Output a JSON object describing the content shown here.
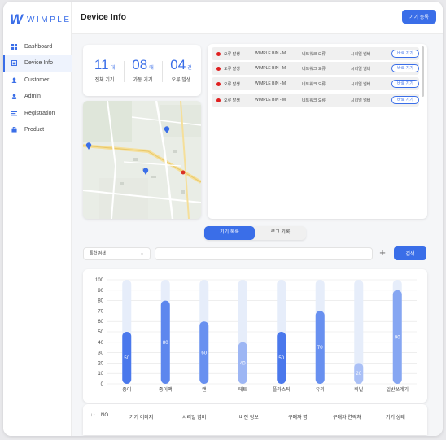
{
  "brand": {
    "mark": "W",
    "wordmark": "WIMPLE",
    "color": "#3a6ee8"
  },
  "sidebar": {
    "items": [
      {
        "label": "Dashboard",
        "icon": "dashboard-icon",
        "active": false
      },
      {
        "label": "Device Info",
        "icon": "device-icon",
        "active": true
      },
      {
        "label": "Customer",
        "icon": "customer-icon",
        "active": false
      },
      {
        "label": "Admin",
        "icon": "admin-icon",
        "active": false
      },
      {
        "label": "Registration",
        "icon": "registration-icon",
        "active": false
      },
      {
        "label": "Product",
        "icon": "product-icon",
        "active": false
      }
    ]
  },
  "header": {
    "title": "Device Info",
    "register_label": "기기 등록"
  },
  "stats": [
    {
      "value": "11",
      "unit": "대",
      "label": "전체 기기"
    },
    {
      "value": "08",
      "unit": "대",
      "label": "가동 기기"
    },
    {
      "value": "04",
      "unit": "건",
      "label": "오류 발생"
    }
  ],
  "alerts": [
    {
      "status": "오류 발생",
      "device": "WIMPLE BIN - M",
      "error": "네트워크 오류",
      "serial": "시리얼 넘버",
      "action": "바로 가기"
    },
    {
      "status": "오류 발생",
      "device": "WIMPLE BIN - M",
      "error": "네트워크 오류",
      "serial": "시리얼 넘버",
      "action": "바로 가기"
    },
    {
      "status": "오류 발생",
      "device": "WIMPLE BIN - M",
      "error": "네트워크 오류",
      "serial": "시리얼 넘버",
      "action": "바로 가기"
    },
    {
      "status": "오류 발생",
      "device": "WIMPLE BIN - M",
      "error": "네트워크 오류",
      "serial": "시리얼 넘버",
      "action": "바로 가기"
    }
  ],
  "tabs": [
    {
      "label": "기기 목록",
      "active": true
    },
    {
      "label": "로그 기록",
      "active": false
    }
  ],
  "search": {
    "select_value": "통합 검색",
    "input_value": "",
    "input_placeholder": "",
    "add_symbol": "+",
    "button_label": "검색"
  },
  "chart_data": {
    "type": "bar",
    "categories": [
      "종이",
      "종이팩",
      "캔",
      "페트",
      "플라스틱",
      "유리",
      "비닐",
      "일반쓰레기"
    ],
    "values": [
      50,
      80,
      60,
      40,
      50,
      70,
      20,
      90
    ],
    "ylim": [
      0,
      100
    ],
    "yticks": [
      0,
      10,
      20,
      30,
      40,
      50,
      60,
      70,
      80,
      90,
      100
    ],
    "grid": true,
    "bar_colors": [
      "#4a78ec",
      "#5d87ee",
      "#6890f0",
      "#9db6f4",
      "#4a78ec",
      "#6890f0",
      "#aac0f6",
      "#86a6f2"
    ],
    "track_color": "#e6edfa"
  },
  "table": {
    "sort_symbol": "↓↑",
    "columns": [
      "NO",
      "기기 이미지",
      "시리얼 넘버",
      "버전 정보",
      "구매자 명",
      "구매자 연락처",
      "기기 상태"
    ]
  }
}
